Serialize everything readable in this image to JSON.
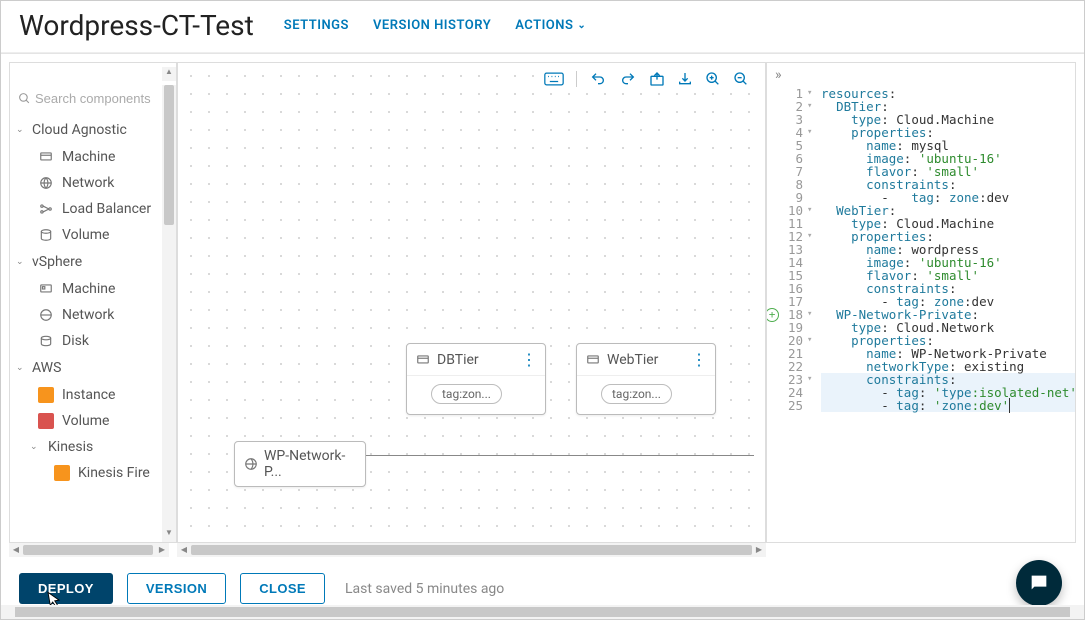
{
  "header": {
    "title": "Wordpress-CT-Test",
    "settings": "SETTINGS",
    "version_history": "VERSION HISTORY",
    "actions": "ACTIONS"
  },
  "sidebar": {
    "search_placeholder": "Search components",
    "sections": [
      {
        "label": "Cloud Agnostic",
        "items": [
          {
            "icon": "machine-icon",
            "label": "Machine"
          },
          {
            "icon": "network-icon",
            "label": "Network"
          },
          {
            "icon": "lb-icon",
            "label": "Load Balancer"
          },
          {
            "icon": "volume-icon",
            "label": "Volume"
          }
        ]
      },
      {
        "label": "vSphere",
        "items": [
          {
            "icon": "machine-icon",
            "label": "Machine"
          },
          {
            "icon": "network-icon",
            "label": "Network"
          },
          {
            "icon": "disk-icon",
            "label": "Disk"
          }
        ]
      },
      {
        "label": "AWS",
        "items": [
          {
            "icon": "instance-icon",
            "label": "Instance"
          },
          {
            "icon": "volume-icon",
            "label": "Volume"
          },
          {
            "icon": "kinesis-icon",
            "label": "Kinesis",
            "expandable": true,
            "children": [
              {
                "icon": "kinesis-fire-icon",
                "label": "Kinesis Fire"
              }
            ]
          }
        ]
      }
    ]
  },
  "canvas": {
    "nodes": {
      "db": {
        "label": "DBTier",
        "tag": "tag:zon..."
      },
      "web": {
        "label": "WebTier",
        "tag": "tag:zon..."
      },
      "net": {
        "label": "WP-Network-P..."
      }
    }
  },
  "code": {
    "raw": "resources:\n  DBTier:\n    type: Cloud.Machine\n    properties:\n      name: mysql\n      image: 'ubuntu-16'\n      flavor: 'small'\n      constraints:\n        -   tag: zone:dev\n  WebTier:\n    type: Cloud.Machine\n    properties:\n      name: wordpress\n      image: 'ubuntu-16'\n      flavor: 'small'\n      constraints:\n        - tag: zone:dev\n  WP-Network-Private:\n    type: Cloud.Network\n    properties:\n      name: WP-Network-Private\n      networkType: existing\n      constraints:\n        - tag: 'type:isolated-net'\n        - tag: 'zone:dev'",
    "highlight_start": 23,
    "highlight_end": 25,
    "add_marker_line": 18,
    "fold_lines": [
      1,
      2,
      4,
      10,
      12,
      18,
      20,
      23
    ]
  },
  "footer": {
    "deploy": "DEPLOY",
    "version": "VERSION",
    "close": "CLOSE",
    "saved": "Last saved 5 minutes ago"
  }
}
